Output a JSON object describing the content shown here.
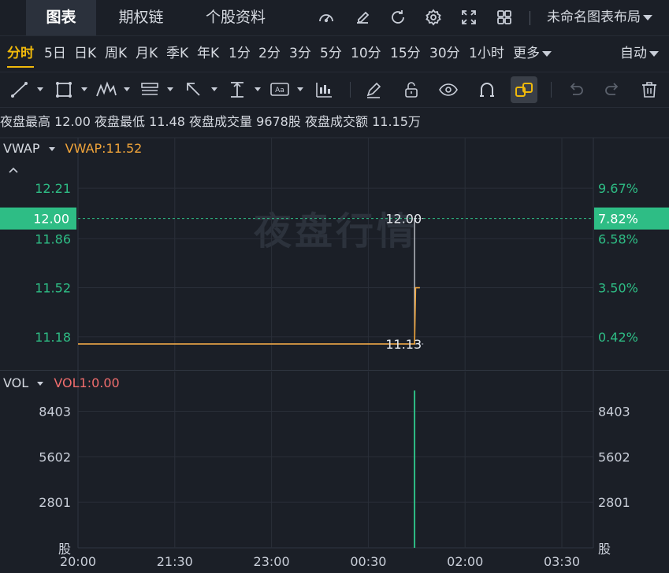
{
  "tabs": [
    {
      "label": "图表",
      "active": true
    },
    {
      "label": "期权链",
      "active": false
    },
    {
      "label": "个股资料",
      "active": false
    }
  ],
  "top_icons": [
    "speedometer-icon",
    "edit-icon",
    "refresh-icon",
    "gear-icon",
    "fullscreen-icon",
    "grid-layout-icon"
  ],
  "layout_name": "未命名图表布局",
  "periods": [
    "分时",
    "5日",
    "日K",
    "周K",
    "月K",
    "季K",
    "年K",
    "1分",
    "2分",
    "3分",
    "5分",
    "10分",
    "15分",
    "30分",
    "1小时",
    "更多"
  ],
  "active_period": "分时",
  "auto_label": "自动",
  "tools": [
    "trend-line-icon",
    "rectangle-icon",
    "wave-pattern-icon",
    "fib-lines-icon",
    "arrow-icon",
    "vertical-measure-icon",
    "text-annotation-icon",
    "candle-indicator-icon",
    "pencil-icon",
    "unlock-icon",
    "eye-icon",
    "magnet-icon",
    "link-chain-icon",
    "undo-icon",
    "redo-icon",
    "trash-icon"
  ],
  "info": {
    "high_label": "夜盘最高",
    "high_value": "12.00",
    "low_label": "夜盘最低",
    "low_value": "11.48",
    "vol_label": "夜盘成交量",
    "vol_value": "9678股",
    "amt_label": "夜盘成交额",
    "amt_value": "11.15万"
  },
  "vwap_legend": {
    "name": "VWAP",
    "value": "VWAP:11.52"
  },
  "vol_legend": {
    "name": "VOL",
    "value": "VOL1:0.00"
  },
  "watermark": "夜盘行情",
  "colors": {
    "background": "#1b1f27",
    "accent": "#f0b90b",
    "up": "#2ebd85",
    "price_line": "#d8dce3",
    "vwap_line": "#f0a43a",
    "vol_label": "#f16d6d"
  },
  "chart_data": {
    "type": "line",
    "x_ticks": [
      "20:00",
      "21:30",
      "23:00",
      "00:30",
      "02:00",
      "03:30"
    ],
    "x_tick_minutes": [
      0,
      90,
      180,
      270,
      360,
      450
    ],
    "price_axis": {
      "ticks": [
        12.21,
        11.86,
        11.52,
        11.18
      ],
      "tick_labels": [
        "12.21",
        "11.86",
        "11.52",
        "11.18"
      ],
      "percent_labels": [
        "9.67%",
        "6.58%",
        "3.50%",
        "0.42%"
      ],
      "ylim": [
        10.95,
        12.56
      ]
    },
    "current_price": {
      "value": 12.0,
      "label": "12.00",
      "percent": "7.82%"
    },
    "price_labels": [
      {
        "value": 12.0,
        "text": "12.00",
        "minute": 305
      },
      {
        "value": 11.13,
        "text": "11.13",
        "minute": 305
      }
    ],
    "series": [
      {
        "name": "price",
        "x": [
          0,
          313,
          313,
          314
        ],
        "y": [
          11.13,
          11.13,
          12.0,
          12.0
        ]
      },
      {
        "name": "VWAP",
        "x": [
          0,
          313,
          314,
          318
        ],
        "y": [
          11.13,
          11.13,
          11.52,
          11.52
        ]
      }
    ],
    "volume": {
      "ticks": [
        8403,
        5602,
        2801
      ],
      "tick_labels": [
        "8403",
        "5602",
        "2801"
      ],
      "unit": "股",
      "ylim": [
        0,
        10850
      ],
      "bars": [
        {
          "minute": 313,
          "value": 9678
        }
      ]
    }
  }
}
